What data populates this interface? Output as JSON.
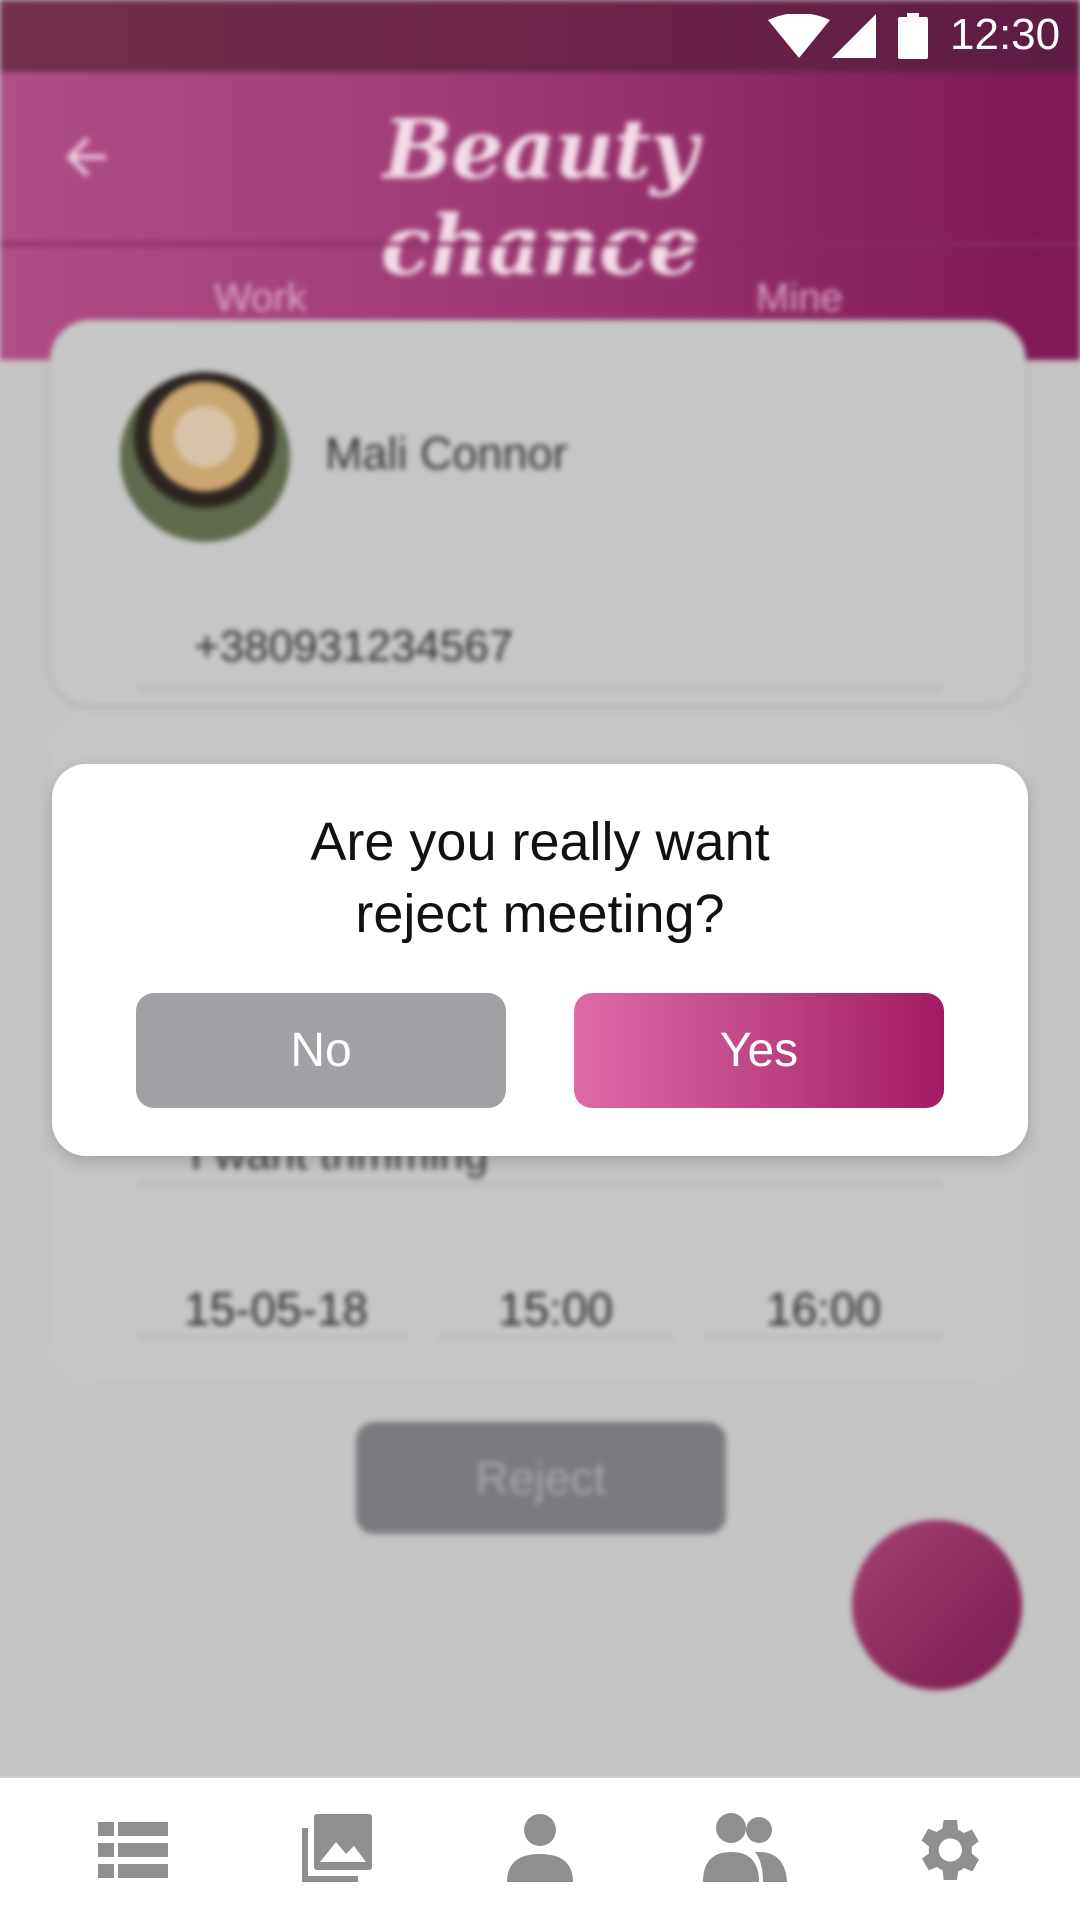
{
  "status_bar": {
    "time": "12:30"
  },
  "header": {
    "brand": "Beauty chance",
    "tabs": [
      "Work",
      "Mine"
    ]
  },
  "card_top": {
    "name": "Mali Connor",
    "phone": "+380931234567"
  },
  "card_mid": {
    "request_text": "I want trimming",
    "date": "15-05-18",
    "time_start": "15:00",
    "time_end": "16:00"
  },
  "actions": {
    "reject_label": "Reject"
  },
  "dialog": {
    "line1": "Are you really want",
    "line2": "reject meeting?",
    "no_label": "No",
    "yes_label": "Yes"
  },
  "bottom_nav": {
    "items": [
      {
        "icon": "list-icon"
      },
      {
        "icon": "gallery-icon"
      },
      {
        "icon": "person-icon"
      },
      {
        "icon": "group-icon"
      },
      {
        "icon": "settings-gear-icon"
      }
    ]
  },
  "colors": {
    "brand_pink": "#c54e8d",
    "brand_dark": "#a31a64",
    "button_gray": "#a0a0a5"
  }
}
